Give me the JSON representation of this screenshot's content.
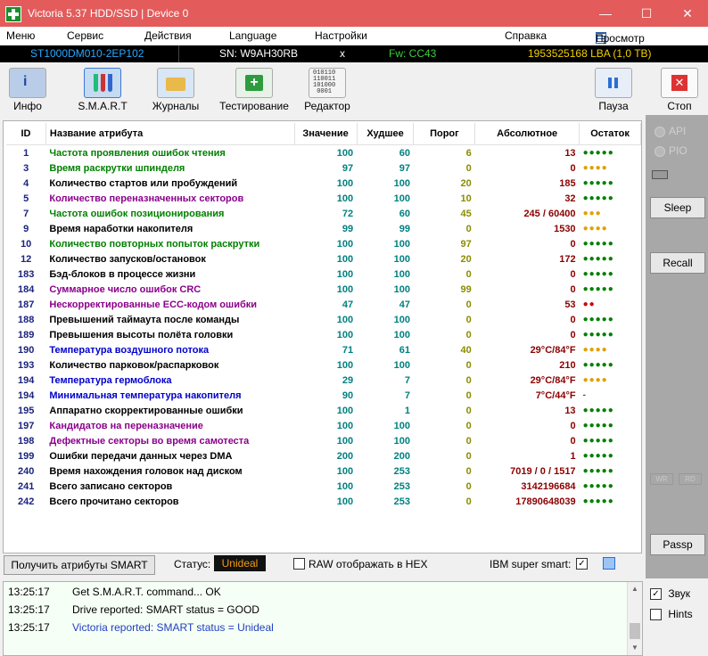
{
  "window": {
    "title": "Victoria 5.37 HDD/SSD | Device 0",
    "minimize": "—",
    "maximize": "☐",
    "close": "✕"
  },
  "menu": {
    "items": [
      "Меню",
      "Сервис",
      "Действия",
      "Language",
      "Настройки",
      "Справка"
    ],
    "buffer": "Просмотр буфера"
  },
  "device": {
    "model": "ST1000DM010-2EP102",
    "sn": "SN: W9AH30RB",
    "x": "x",
    "fw": "Fw: CC43",
    "lba": "1953525168 LBA (1,0 TB)"
  },
  "toolbar": {
    "info": "Инфо",
    "smart": "S.M.A.R.T",
    "logs": "Журналы",
    "testing": "Тестирование",
    "editor": "Редактор",
    "pause": "Пауза",
    "stop": "Стоп"
  },
  "table": {
    "headers": {
      "id": "ID",
      "name": "Название атрибута",
      "value": "Значение",
      "worst": "Худшее",
      "threshold": "Порог",
      "raw": "Абсолютное",
      "remain": "Остаток"
    },
    "rows": [
      {
        "id": "1",
        "name": "Частота проявления ошибок чтения",
        "value": "100",
        "worst": "60",
        "thr": "6",
        "raw": "13",
        "rem": "●●●●●",
        "color": "#008000",
        "remcolor": "#008000"
      },
      {
        "id": "3",
        "name": "Время раскрутки шпинделя",
        "value": "97",
        "worst": "97",
        "thr": "0",
        "raw": "0",
        "rem": "●●●●",
        "color": "#008000",
        "remcolor": "#e0a000"
      },
      {
        "id": "4",
        "name": "Количество стартов или пробуждений",
        "value": "100",
        "worst": "100",
        "thr": "20",
        "raw": "185",
        "rem": "●●●●●",
        "color": "#000000",
        "remcolor": "#008000"
      },
      {
        "id": "5",
        "name": "Количество переназначенных секторов",
        "value": "100",
        "worst": "100",
        "thr": "10",
        "raw": "32",
        "rem": "●●●●●",
        "color": "#8b008b",
        "remcolor": "#008000"
      },
      {
        "id": "7",
        "name": "Частота ошибок позиционирования",
        "value": "72",
        "worst": "60",
        "thr": "45",
        "raw": "245 / 60400",
        "rem": "●●●",
        "color": "#008000",
        "remcolor": "#e0a000"
      },
      {
        "id": "9",
        "name": "Время наработки накопителя",
        "value": "99",
        "worst": "99",
        "thr": "0",
        "raw": "1530",
        "rem": "●●●●",
        "color": "#000000",
        "remcolor": "#e0a000"
      },
      {
        "id": "10",
        "name": "Количество повторных попыток раскрутки",
        "value": "100",
        "worst": "100",
        "thr": "97",
        "raw": "0",
        "rem": "●●●●●",
        "color": "#008000",
        "remcolor": "#008000"
      },
      {
        "id": "12",
        "name": "Количество запусков/остановок",
        "value": "100",
        "worst": "100",
        "thr": "20",
        "raw": "172",
        "rem": "●●●●●",
        "color": "#000000",
        "remcolor": "#008000"
      },
      {
        "id": "183",
        "name": "Бэд-блоков в процессе жизни",
        "value": "100",
        "worst": "100",
        "thr": "0",
        "raw": "0",
        "rem": "●●●●●",
        "color": "#000000",
        "remcolor": "#008000"
      },
      {
        "id": "184",
        "name": "Суммарное число ошибок CRC",
        "value": "100",
        "worst": "100",
        "thr": "99",
        "raw": "0",
        "rem": "●●●●●",
        "color": "#8b008b",
        "remcolor": "#008000"
      },
      {
        "id": "187",
        "name": "Нескорректированные ECC-кодом ошибки",
        "value": "47",
        "worst": "47",
        "thr": "0",
        "raw": "53",
        "rem": "●●",
        "color": "#8b008b",
        "remcolor": "#d00000"
      },
      {
        "id": "188",
        "name": "Превышений таймаута после команды",
        "value": "100",
        "worst": "100",
        "thr": "0",
        "raw": "0",
        "rem": "●●●●●",
        "color": "#000000",
        "remcolor": "#008000"
      },
      {
        "id": "189",
        "name": "Превышения высоты полёта головки",
        "value": "100",
        "worst": "100",
        "thr": "0",
        "raw": "0",
        "rem": "●●●●●",
        "color": "#000000",
        "remcolor": "#008000"
      },
      {
        "id": "190",
        "name": "Температура воздушного потока",
        "value": "71",
        "worst": "61",
        "thr": "40",
        "raw": "29°C/84°F",
        "rem": "●●●●",
        "color": "#0000cd",
        "remcolor": "#e0a000"
      },
      {
        "id": "193",
        "name": "Количество парковок/распарковок",
        "value": "100",
        "worst": "100",
        "thr": "0",
        "raw": "210",
        "rem": "●●●●●",
        "color": "#000000",
        "remcolor": "#008000"
      },
      {
        "id": "194",
        "name": "Температура гермоблока",
        "value": "29",
        "worst": "7",
        "thr": "0",
        "raw": "29°C/84°F",
        "rem": "●●●●",
        "color": "#0000cd",
        "remcolor": "#e0a000"
      },
      {
        "id": "194",
        "name": "Минимальная температура накопителя",
        "value": "90",
        "worst": "7",
        "thr": "0",
        "raw": "7°C/44°F",
        "rem": "-",
        "color": "#0000cd",
        "remcolor": "#008000"
      },
      {
        "id": "195",
        "name": "Аппаратно скорректированные ошибки",
        "value": "100",
        "worst": "1",
        "thr": "0",
        "raw": "13",
        "rem": "●●●●●",
        "color": "#000000",
        "remcolor": "#008000"
      },
      {
        "id": "197",
        "name": "Кандидатов на переназначение",
        "value": "100",
        "worst": "100",
        "thr": "0",
        "raw": "0",
        "rem": "●●●●●",
        "color": "#8b008b",
        "remcolor": "#008000"
      },
      {
        "id": "198",
        "name": "Дефектные секторы во время самотеста",
        "value": "100",
        "worst": "100",
        "thr": "0",
        "raw": "0",
        "rem": "●●●●●",
        "color": "#8b008b",
        "remcolor": "#008000"
      },
      {
        "id": "199",
        "name": "Ошибки передачи данных через DMA",
        "value": "200",
        "worst": "200",
        "thr": "0",
        "raw": "1",
        "rem": "●●●●●",
        "color": "#000000",
        "remcolor": "#008000"
      },
      {
        "id": "240",
        "name": "Время нахождения головок над диском",
        "value": "100",
        "worst": "253",
        "thr": "0",
        "raw": "7019 / 0 / 1517",
        "rem": "●●●●●",
        "color": "#000000",
        "remcolor": "#008000"
      },
      {
        "id": "241",
        "name": "Всего записано секторов",
        "value": "100",
        "worst": "253",
        "thr": "0",
        "raw": "3142196684",
        "rem": "●●●●●",
        "color": "#000000",
        "remcolor": "#008000"
      },
      {
        "id": "242",
        "name": "Всего прочитано секторов",
        "value": "100",
        "worst": "253",
        "thr": "0",
        "raw": "17890648039",
        "rem": "●●●●●",
        "color": "#000000",
        "remcolor": "#008000"
      }
    ]
  },
  "side": {
    "api": "API",
    "pio": "PIO",
    "sleep": "Sleep",
    "recall": "Recall",
    "wr": "WR",
    "rd": "RD",
    "passp": "Passp"
  },
  "bottom": {
    "get_smart": "Получить атрибуты SMART",
    "status_label": "Статус:",
    "status_value": "Unideal",
    "raw_hex": "RAW отображать в HEX",
    "ibm": "IBM super smart:"
  },
  "log": [
    {
      "time": "13:25:17",
      "msg": "Get S.M.A.R.T. command... OK",
      "color": "#000000"
    },
    {
      "time": "13:25:17",
      "msg": "Drive reported: SMART status = GOOD",
      "color": "#000000"
    },
    {
      "time": "13:25:17",
      "msg": "Victoria reported: SMART status = Unideal",
      "color": "#1f3fbf"
    }
  ],
  "options": {
    "sound": "Звук",
    "hints": "Hints"
  }
}
